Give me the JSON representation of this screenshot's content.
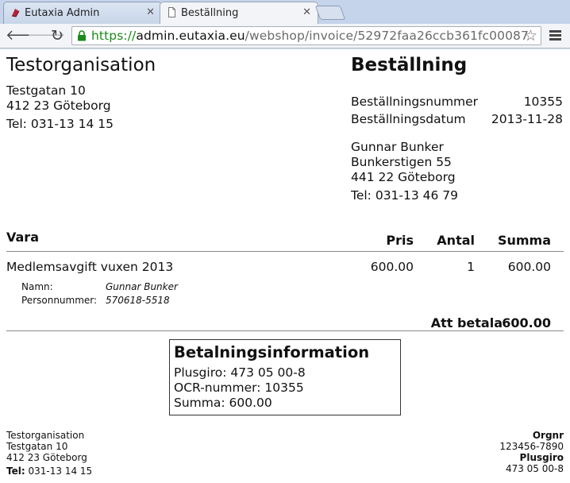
{
  "browser": {
    "tabs": [
      {
        "label": "Eutaxia Admin",
        "favicon": "eutaxia-logo-icon"
      },
      {
        "label": "Beställning",
        "favicon": "page-icon"
      }
    ],
    "url_scheme": "https://",
    "url_host": "admin.eutaxia.eu",
    "url_path": "/webshop/invoice/52972faa26ccb361fc00087"
  },
  "seller": {
    "name": "Testorganisation",
    "street": "Testgatan 10",
    "city": "412 23 Göteborg",
    "tel": "Tel: 031-13 14 15"
  },
  "order": {
    "title": "Beställning",
    "number_label": "Beställningsnummer",
    "number_value": "10355",
    "date_label": "Beställningsdatum",
    "date_value": "2013-11-28"
  },
  "customer": {
    "name": "Gunnar Bunker",
    "street": "Bunkerstigen 55",
    "city": "441 22 Göteborg",
    "tel": "Tel: 031-13 46 79"
  },
  "table": {
    "headers": {
      "item": "Vara",
      "price": "Pris",
      "qty": "Antal",
      "sum": "Summa"
    },
    "rows": [
      {
        "item": "Medlemsavgift vuxen 2013",
        "price": "600.00",
        "qty": "1",
        "sum": "600.00",
        "details": [
          {
            "label": "Namn:",
            "value": "Gunnar Bunker"
          },
          {
            "label": "Personnummer:",
            "value": "570618-5518"
          }
        ]
      }
    ],
    "total_label": "Att betala",
    "total_value": "600.00"
  },
  "payment": {
    "title": "Betalningsinformation",
    "plusgiro": "Plusgiro: 473 05 00-8",
    "ocr": "OCR-nummer: 10355",
    "summa": "Summa: 600.00"
  },
  "footer": {
    "org": "Testorganisation",
    "street": "Testgatan 10",
    "city": "412 23 Göteborg",
    "tel_label": "Tel:",
    "tel_value": "031-13 14 15",
    "orgnr_label": "Orgnr",
    "orgnr_value": "123456-7890",
    "plusgiro_label": "Plusgiro",
    "plusgiro_value": "473 05 00-8"
  }
}
